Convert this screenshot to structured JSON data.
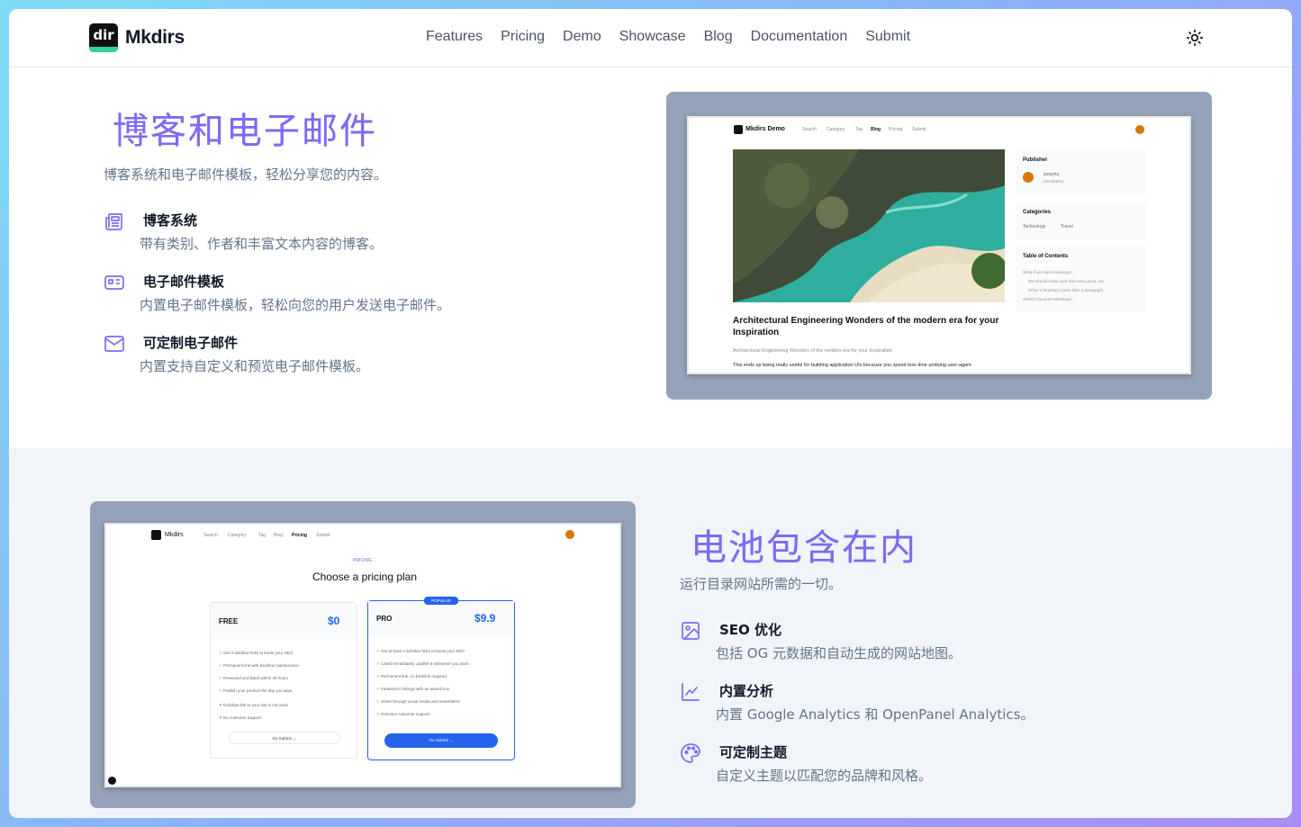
{
  "header": {
    "brand": "Mkdirs",
    "logo_text": "dir",
    "nav": [
      "Features",
      "Pricing",
      "Demo",
      "Showcase",
      "Blog",
      "Documentation",
      "Submit"
    ]
  },
  "section1": {
    "title": "博客和电子邮件",
    "subtitle": "博客系统和电子邮件模板，轻松分享您的内容。",
    "features": [
      {
        "icon": "newspaper-icon",
        "name": "博客系统",
        "desc": "带有类别、作者和丰富文本内容的博客。"
      },
      {
        "icon": "mail-template-icon",
        "name": "电子邮件模板",
        "desc": "内置电子邮件模板，轻松向您的用户发送电子邮件。"
      },
      {
        "icon": "mail-icon",
        "name": "可定制电子邮件",
        "desc": "内置支持自定义和预览电子邮件模板。"
      }
    ],
    "preview": {
      "brand": "Mkdirs Demo",
      "nav": [
        "Search",
        "Category",
        "Tag",
        "Blog",
        "Pricing",
        "Submit"
      ],
      "publisher_label": "Publisher",
      "publisher_name": "javayhu",
      "publisher_date": "2024/09/04",
      "categories_label": "Categories",
      "categories": [
        "Technology",
        "Travel"
      ],
      "toc_label": "Table of Contents",
      "toc": [
        "What if we stack Headings?",
        "We should make sure that looks good, too.",
        "When a heading comes after a paragraph",
        "GitHub Flavored Markdown"
      ],
      "post_title": "Architectural Engineering Wonders of the modern era for your Inspiration",
      "post_sub": "Architectural Engineering Wonders of the modern era for your Inspiration",
      "post_text": "This ends up being really useful for building application UIs because you spend less time undoing user-agent"
    }
  },
  "section2": {
    "title": "电池包含在内",
    "subtitle": "运行目录网站所需的一切。",
    "features": [
      {
        "icon": "image-icon",
        "name": "SEO 优化",
        "desc": "包括 OG 元数据和自动生成的网站地图。"
      },
      {
        "icon": "chart-icon",
        "name": "内置分析",
        "desc": "内置 Google Analytics 和 OpenPanel Analytics。"
      },
      {
        "icon": "palette-icon",
        "name": "可定制主题",
        "desc": "自定义主题以匹配您的品牌和风格。"
      }
    ],
    "preview": {
      "brand": "Mkdirs",
      "nav": [
        "Search",
        "Category",
        "Tag",
        "Blog",
        "Pricing",
        "Submit"
      ],
      "eyebrow": "PRICING",
      "heading": "Choose a pricing plan",
      "free": {
        "name": "FREE",
        "price": "$0",
        "button": "Go Submit",
        "items_ok": [
          "Get 3 dofollow links to boost your SEO",
          "Permanent link with backlink maintenance",
          "Reviewed and listed within 48 hours",
          "Publish your product the day you want"
        ],
        "items_no": [
          "Dofollow link to your site is not used",
          "No customer support"
        ]
      },
      "pro": {
        "badge": "POPULAR",
        "name": "PRO",
        "price": "$9.9",
        "button": "Go Submit",
        "items_ok": [
          "Get at least 3 dofollow links to boost your SEO",
          "Listed immediately, publish it whenever you want",
          "Permanent link, no backlink required",
          "Featured in listings with an award icon",
          "Share through social media and newsletters",
          "Premium customer support"
        ]
      }
    }
  },
  "colors": {
    "accent": "#7c6cf0",
    "frame": "#94a3b8",
    "pro_blue": "#2563eb"
  }
}
